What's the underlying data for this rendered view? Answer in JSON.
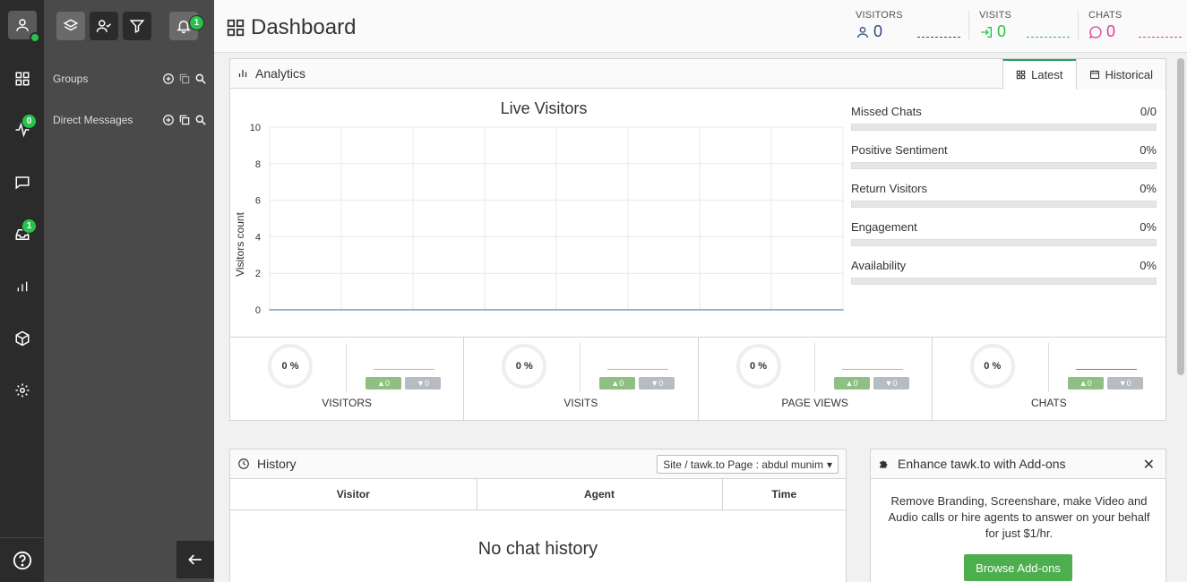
{
  "rail": {
    "inbox_badge": "1",
    "activity_badge": "0"
  },
  "panel": {
    "notif_badge": "1",
    "groups_label": "Groups",
    "dm_label": "Direct Messages"
  },
  "header": {
    "title": "Dashboard",
    "stats": [
      {
        "caption": "VISITORS",
        "value": "0",
        "color": "#2e4a7d"
      },
      {
        "caption": "VISITS",
        "value": "0",
        "color": "#27c24c"
      },
      {
        "caption": "CHATS",
        "value": "0",
        "color": "#e03c9c"
      }
    ]
  },
  "analytics": {
    "title": "Analytics",
    "tab_latest": "Latest",
    "tab_historical": "Historical",
    "chart_title": "Live Visitors",
    "ylabel": "Visitors count",
    "yticks": [
      "10",
      "8",
      "6",
      "4",
      "2",
      "0"
    ],
    "metrics": [
      {
        "label": "Missed Chats",
        "value": "0/0"
      },
      {
        "label": "Positive Sentiment",
        "value": "0%"
      },
      {
        "label": "Return Visitors",
        "value": "0%"
      },
      {
        "label": "Engagement",
        "value": "0%"
      },
      {
        "label": "Availability",
        "value": "0%"
      }
    ],
    "kpis": [
      {
        "percent": "0 %",
        "up": "0",
        "down": "0",
        "name": "VISITORS",
        "spark": "#f0a35e"
      },
      {
        "percent": "0 %",
        "up": "0",
        "down": "0",
        "name": "VISITS",
        "spark": "#f0a35e"
      },
      {
        "percent": "0 %",
        "up": "0",
        "down": "0",
        "name": "PAGE VIEWS",
        "spark": "#f0a35e"
      },
      {
        "percent": "0 %",
        "up": "0",
        "down": "0",
        "name": "CHATS",
        "spark": "#e05050"
      }
    ]
  },
  "chart_data": {
    "type": "line",
    "title": "Live Visitors",
    "xlabel": "",
    "ylabel": "Visitors count",
    "ylim": [
      0,
      10
    ],
    "series": [
      {
        "values": [
          0,
          0,
          0,
          0,
          0,
          0,
          0,
          0,
          0
        ]
      }
    ]
  },
  "history": {
    "title": "History",
    "select_value": "Site / tawk.to Page : abdul munim",
    "columns": [
      "Visitor",
      "Agent",
      "Time"
    ],
    "empty": "No chat history"
  },
  "addons": {
    "title": "Enhance tawk.to with Add-ons",
    "text": "Remove Branding, Screenshare, make Video and Audio calls or hire agents to answer on your behalf for just $1/hr.",
    "button": "Browse Add-ons"
  }
}
